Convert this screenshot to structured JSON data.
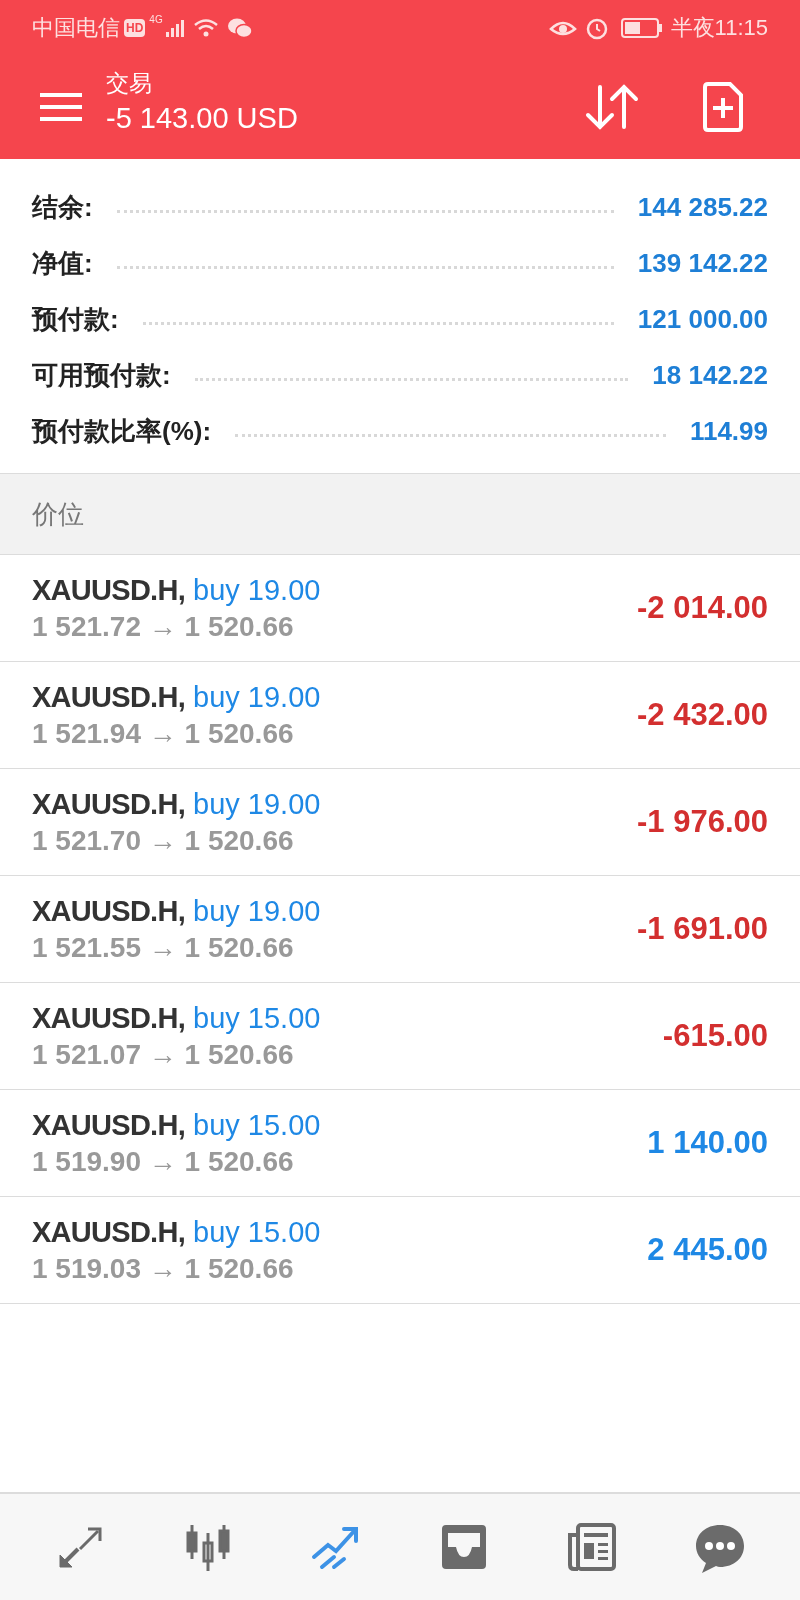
{
  "status_bar": {
    "carrier": "中国电信",
    "hd": "HD",
    "network": "4G",
    "time": "半夜11:15"
  },
  "header": {
    "title": "交易",
    "balance": "-5 143.00 USD"
  },
  "summary": [
    {
      "label": "结余:",
      "value": "144 285.22"
    },
    {
      "label": "净值:",
      "value": "139 142.22"
    },
    {
      "label": "预付款:",
      "value": "121 000.00"
    },
    {
      "label": "可用预付款:",
      "value": "18 142.22"
    },
    {
      "label": "预付款比率(%):",
      "value": "114.99"
    }
  ],
  "positions_header": "价位",
  "positions": [
    {
      "symbol": "XAUUSD.H,",
      "side": "buy 19.00",
      "prices": "1 521.72 → 1 520.66",
      "profit": "-2 014.00",
      "color": "#d32f2f"
    },
    {
      "symbol": "XAUUSD.H,",
      "side": "buy 19.00",
      "prices": "1 521.94 → 1 520.66",
      "profit": "-2 432.00",
      "color": "#d32f2f"
    },
    {
      "symbol": "XAUUSD.H,",
      "side": "buy 19.00",
      "prices": "1 521.70 → 1 520.66",
      "profit": "-1 976.00",
      "color": "#d32f2f"
    },
    {
      "symbol": "XAUUSD.H,",
      "side": "buy 19.00",
      "prices": "1 521.55 → 1 520.66",
      "profit": "-1 691.00",
      "color": "#d32f2f"
    },
    {
      "symbol": "XAUUSD.H,",
      "side": "buy 15.00",
      "prices": "1 521.07 → 1 520.66",
      "profit": "-615.00",
      "color": "#d32f2f"
    },
    {
      "symbol": "XAUUSD.H,",
      "side": "buy 15.00",
      "prices": "1 519.90 → 1 520.66",
      "profit": "1 140.00",
      "color": "#1e88e5"
    },
    {
      "symbol": "XAUUSD.H,",
      "side": "buy 15.00",
      "prices": "1 519.03 → 1 520.66",
      "profit": "2 445.00",
      "color": "#1e88e5"
    }
  ],
  "nav": [
    {
      "kind": "quotes",
      "selected": false
    },
    {
      "kind": "chart",
      "selected": false
    },
    {
      "kind": "trade",
      "selected": true
    },
    {
      "kind": "inbox",
      "selected": false
    },
    {
      "kind": "news",
      "selected": false
    },
    {
      "kind": "chat",
      "selected": false
    }
  ]
}
